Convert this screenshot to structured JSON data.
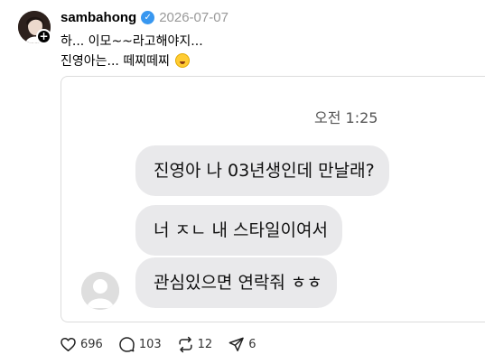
{
  "post": {
    "username": "sambahong",
    "date": "2026-07-07",
    "caption_lines": [
      "하... 이모~~라고해야지...",
      "진영아는... 떼찌떼찌"
    ]
  },
  "chat": {
    "time": "오전 1:25",
    "messages": [
      "진영아 나 03년생인데 만날래?",
      "너 ㅈㄴ 내 스타일이여서",
      "관심있으면 연락줘 ㅎㅎ"
    ]
  },
  "actions": {
    "likes": "696",
    "comments": "103",
    "reposts": "12",
    "shares": "6"
  },
  "icons": {
    "verified": "verified-badge-icon",
    "follow": "plus-icon",
    "like": "heart-icon",
    "comment": "comment-bubble-icon",
    "repost": "repost-icon",
    "share": "share-icon",
    "caption_emoji": "laughing-emoji-icon"
  },
  "colors": {
    "verified": "#3897f0",
    "bubble": "#e9e9eb",
    "date": "#999999"
  }
}
